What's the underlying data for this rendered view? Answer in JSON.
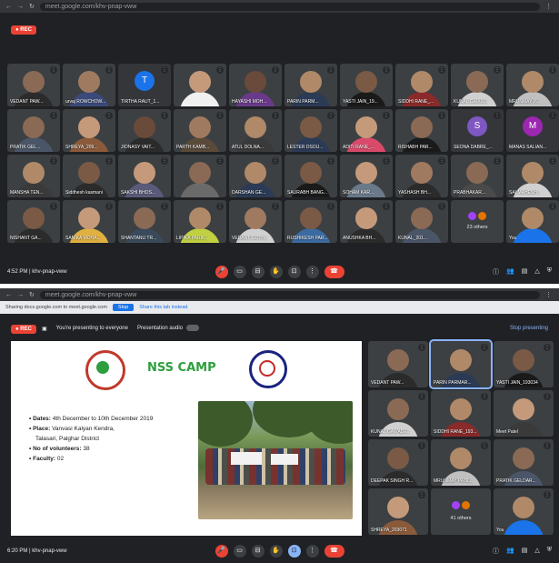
{
  "screen1": {
    "browser_url": "meet.google.com/khv-pnap-vww",
    "rec_label": "REC",
    "participants": [
      {
        "name": "VEDANT PAW...",
        "type": "video",
        "skin": "#8a6a55",
        "shirt": "#2b2b2b"
      },
      {
        "name": "urvaj ROWCHOW...",
        "type": "video",
        "skin": "#a07a60",
        "shirt": "#3b4a7a"
      },
      {
        "name": "TIRTHA RAUT_1...",
        "type": "avatar",
        "initial": "T",
        "color": "#1a73e8"
      },
      {
        "name": "",
        "type": "video",
        "skin": "#c49a7a",
        "shirt": "#f0f0f0"
      },
      {
        "name": "HAYASHI MOH...",
        "type": "video",
        "skin": "#6a4a3a",
        "shirt": "#6a3a8a"
      },
      {
        "name": "PARIN PARM...",
        "type": "video",
        "skin": "#b08968",
        "shirt": "#2b3a55"
      },
      {
        "name": "YASTI JAIN_19...",
        "type": "video",
        "skin": "#7a5a45",
        "shirt": "#1a1a1a"
      },
      {
        "name": "SIDDHI RANE_...",
        "type": "video",
        "skin": "#b08968",
        "shirt": "#8a2a2a"
      },
      {
        "name": "KUNAL GAIKW...",
        "type": "video",
        "skin": "#8a6a55",
        "shirt": "#d0d0d0"
      },
      {
        "name": "MRUNMAY P...",
        "type": "video",
        "skin": "#b08968",
        "shirt": "#c0c0c0"
      },
      {
        "name": "PRATIK GEL...",
        "type": "video",
        "skin": "#8a6a55",
        "shirt": "#4a5568"
      },
      {
        "name": "SHREYA_209...",
        "type": "video",
        "skin": "#c49a7a",
        "shirt": "#8a5a3a"
      },
      {
        "name": "JIONASY VAIT...",
        "type": "video",
        "skin": "#6a4a3a",
        "shirt": "#2b2b2b"
      },
      {
        "name": "PARTH KAMB...",
        "type": "video",
        "skin": "#a07a60",
        "shirt": "#5a4a3a"
      },
      {
        "name": "ATUL DOLNA...",
        "type": "video",
        "skin": "#b08968",
        "shirt": "#3a3a3a"
      },
      {
        "name": "LESTER DSOU...",
        "type": "video",
        "skin": "#7a5a45",
        "shirt": "#2b3a55"
      },
      {
        "name": "ADITI RANE_...",
        "type": "video",
        "skin": "#c49a7a",
        "shirt": "#d94a6a"
      },
      {
        "name": "RISHABH PAR...",
        "type": "video",
        "skin": "#8a6a55",
        "shirt": "#1a1a1a"
      },
      {
        "name": "SEONA DABRE_...",
        "type": "avatar",
        "initial": "S",
        "color": "#7e57c2"
      },
      {
        "name": "MANAS SALIAN...",
        "type": "avatar",
        "initial": "M",
        "color": "#9c27b0"
      },
      {
        "name": "MANSHA TEN...",
        "type": "video",
        "skin": "#b08968",
        "shirt": "#3a3a3a"
      },
      {
        "name": "Siddhesh kasmani",
        "type": "video",
        "skin": "#7a5a45",
        "shirt": "#2b2b2b"
      },
      {
        "name": "SAKSHI BHOS...",
        "type": "video",
        "skin": "#c49a7a",
        "shirt": "#5a5a7a"
      },
      {
        "name": "",
        "type": "video",
        "skin": "#8a6a55",
        "shirt": "#6a6a6a"
      },
      {
        "name": "DARSHAN GE...",
        "type": "video",
        "skin": "#b08968",
        "shirt": "#2b3a55"
      },
      {
        "name": "SAURABH BANG...",
        "type": "video",
        "skin": "#7a5a45",
        "shirt": "#1a1a1a"
      },
      {
        "name": "SOHAM KAR...",
        "type": "video",
        "skin": "#c49a7a",
        "shirt": "#6a7a8a"
      },
      {
        "name": "YASHASH BH...",
        "type": "video",
        "skin": "#a07a60",
        "shirt": "#2b2b2b"
      },
      {
        "name": "PRABHAKAR...",
        "type": "video",
        "skin": "#8a6a55",
        "shirt": "#4a4a4a"
      },
      {
        "name": "SAI MAHESH...",
        "type": "video",
        "skin": "#b08968",
        "shirt": "#d0d0d0"
      },
      {
        "name": "NISHANT GA...",
        "type": "video",
        "skin": "#7a5a45",
        "shirt": "#2b2b2b"
      },
      {
        "name": "SANIKA MOHA...",
        "type": "video",
        "skin": "#c49a7a",
        "shirt": "#e0b040"
      },
      {
        "name": "SHANTANU TR...",
        "type": "video",
        "skin": "#8a6a55",
        "shirt": "#3a4a5a"
      },
      {
        "name": "LIPIKA PARIK...",
        "type": "video",
        "skin": "#b08968",
        "shirt": "#c0d040"
      },
      {
        "name": "VEDANT GOTH...",
        "type": "video",
        "skin": "#a07a60",
        "shirt": "#d0d0d0"
      },
      {
        "name": "RUSHIKESH PAR...",
        "type": "video",
        "skin": "#7a5a45",
        "shirt": "#3a6aa0"
      },
      {
        "name": "ANUSHKA BH...",
        "type": "video",
        "skin": "#c49a7a",
        "shirt": "#2b2b2b"
      },
      {
        "name": "KUNAL_201...",
        "type": "video",
        "skin": "#8a6a55",
        "shirt": "#4a5568"
      },
      {
        "name": "23 others",
        "type": "others"
      },
      {
        "name": "You",
        "type": "video",
        "skin": "#b08968",
        "shirt": "#1a73e8"
      }
    ],
    "time_meeting": "4:52 PM | khv-pnap-vww"
  },
  "screen2": {
    "browser_url": "meet.google.com/khv-pnap-vww",
    "share_notice": "Sharing docs.google.com to meet.google.com",
    "stop_label": "Stop",
    "hide_label": "Share this tab instead",
    "rec_label": "REC",
    "presenting_text": "You're presenting to everyone",
    "presentation_audio": "Presentation audio",
    "stop_presenting": "Stop presenting",
    "slide": {
      "title": "NSS CAMP",
      "dates_label": "Dates:",
      "dates_value": "4th December to 10th December 2019",
      "place_label": "Place:",
      "place_value": "Vanvasi Kalyan Kendra,",
      "place_line2": "Talasari, Palghar District",
      "volunteers_label": "No of volunteers:",
      "volunteers_value": "38",
      "faculty_label": "Faculty:",
      "faculty_value": "02"
    },
    "side_participants": [
      {
        "name": "VEDANT PAW...",
        "type": "video",
        "skin": "#8a6a55",
        "shirt": "#2b2b2b"
      },
      {
        "name": "PARIN PARMAR...",
        "type": "video",
        "skin": "#b08968",
        "shirt": "#2b3a55",
        "pinned": true
      },
      {
        "name": "YASTI JAIN_193034",
        "type": "video",
        "skin": "#7a5a45",
        "shirt": "#1a1a1a"
      },
      {
        "name": "KUNAL GAWADE...",
        "type": "video",
        "skin": "#8a6a55",
        "shirt": "#d0d0d0"
      },
      {
        "name": "SIDDHI RANE_193...",
        "type": "video",
        "skin": "#b08968",
        "shirt": "#8a2a2a"
      },
      {
        "name": "Meet Patel",
        "type": "video",
        "skin": "#c49a7a",
        "shirt": "#3a3a3a"
      },
      {
        "name": "DEEPAK SINGH R...",
        "type": "video",
        "skin": "#7a5a45",
        "shirt": "#2b2b2b"
      },
      {
        "name": "MRUNMAY PATIL...",
        "type": "video",
        "skin": "#b08968",
        "shirt": "#c0c0c0"
      },
      {
        "name": "PRATIK GELDAR...",
        "type": "video",
        "skin": "#8a6a55",
        "shirt": "#4a5568"
      },
      {
        "name": "SHREYA_203071",
        "type": "video",
        "skin": "#c49a7a",
        "shirt": "#8a5a3a"
      },
      {
        "name": "41 others",
        "type": "others"
      },
      {
        "name": "You",
        "type": "video",
        "skin": "#b08968",
        "shirt": "#1a73e8"
      }
    ],
    "time_meeting": "6:20 PM | khv-pnap-vww"
  },
  "controls": {
    "mic": "🎤",
    "cam": "▭",
    "cc": "⊟",
    "hand": "✋",
    "present": "⊡",
    "more": "⋮",
    "end": "☎",
    "info": "ⓘ",
    "people": "👥",
    "chat": "▤",
    "activities": "△",
    "lock": "⛨"
  },
  "colors": {
    "meet_bg": "#202124",
    "tile_bg": "#3c4043",
    "red": "#ea4335",
    "blue": "#8ab4f8",
    "nss_green": "#2e9e3e"
  }
}
